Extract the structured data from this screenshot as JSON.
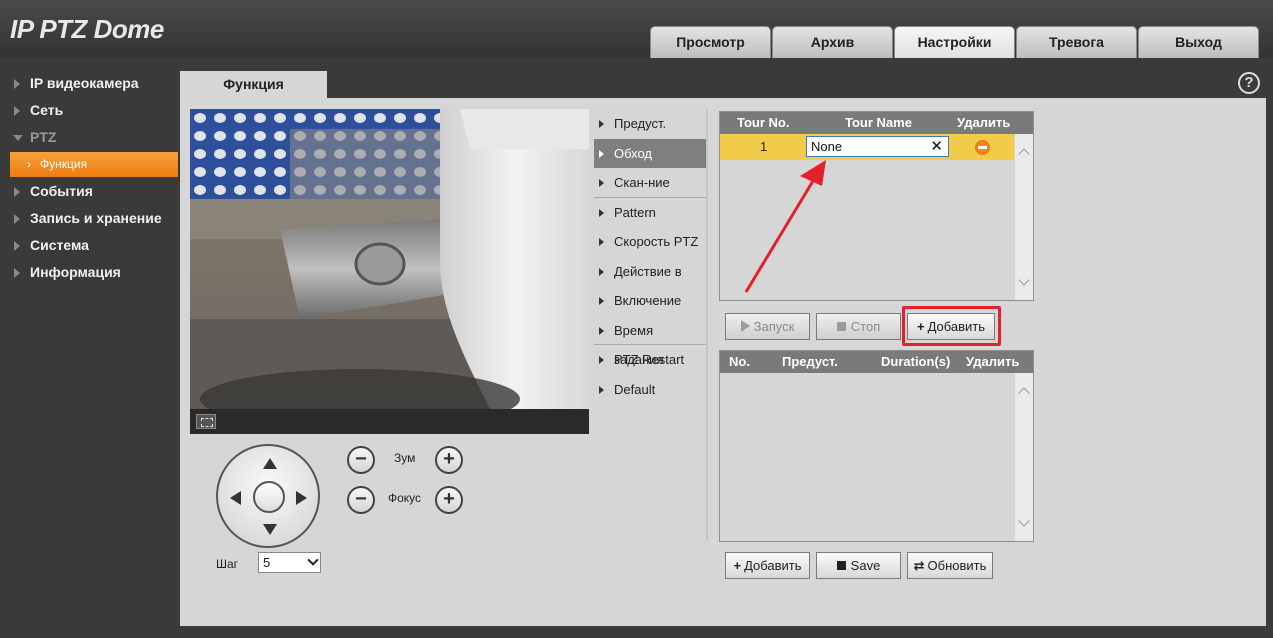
{
  "header": {
    "logo": "IP PTZ Dome",
    "tabs": [
      {
        "label": "Просмотр"
      },
      {
        "label": "Архив"
      },
      {
        "label": "Настройки"
      },
      {
        "label": "Тревога"
      },
      {
        "label": "Выход"
      }
    ],
    "active_tab": "Настройки"
  },
  "sidebar": {
    "items": [
      {
        "label": "IP видеокамера"
      },
      {
        "label": "Сеть"
      },
      {
        "label": "PTZ"
      },
      {
        "label": "События"
      },
      {
        "label": "Запись и хранение"
      },
      {
        "label": "Система"
      },
      {
        "label": "Информация"
      }
    ],
    "sub_item": {
      "label": "Функция"
    }
  },
  "content": {
    "tab": "Функция",
    "help": "?"
  },
  "controls": {
    "zoom_label": "Зум",
    "focus_label": "Фокус",
    "minus": "−",
    "plus": "+",
    "step_label": "Шаг",
    "step_value": "5"
  },
  "function_menu": {
    "items": [
      {
        "label": "Предуст."
      },
      {
        "label": "Обход"
      },
      {
        "label": "Скан-ние"
      },
      {
        "label": "Pattern"
      },
      {
        "label": "Скорость PTZ"
      },
      {
        "label": "Действие в"
      },
      {
        "label": "Включение"
      },
      {
        "label": "Время задания"
      },
      {
        "label": "PTZ Restart"
      },
      {
        "label": "Default"
      }
    ],
    "active": "Обход"
  },
  "tour_table": {
    "columns": [
      "Tour No.",
      "Tour Name",
      "Удалить"
    ],
    "rows": [
      {
        "no": "1",
        "name": "None"
      }
    ],
    "clear_glyph": "✕"
  },
  "tour_buttons": {
    "start": "Запуск",
    "stop": "Стоп",
    "add": "Добавить"
  },
  "preset_table": {
    "columns": [
      "No.",
      "Предуст.",
      "Duration(s)",
      "Удалить"
    ]
  },
  "bottom_buttons": {
    "add": "Добавить",
    "save": "Save",
    "refresh": "Обновить"
  },
  "colors": {
    "accent_orange": "#ef7d11",
    "row_highlight": "#f2cc48",
    "annotation_red": "#e5202a"
  }
}
